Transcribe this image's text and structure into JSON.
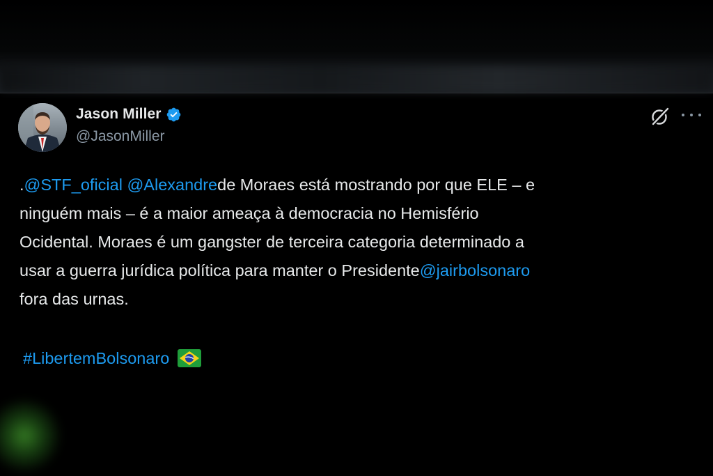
{
  "author": {
    "display_name": "Jason Miller",
    "handle": "@JasonMiller",
    "verified": true,
    "avatar_icon": "profile-photo"
  },
  "actions": {
    "grok_icon": "grok-icon",
    "more_icon": "more-options-icon"
  },
  "tweet": {
    "line1": {
      "prefix": ".",
      "mention1": "@STF_oficial",
      "space": " ",
      "mention2": "@Alexandre",
      "rest": "de Moraes está mostrando por que ELE – e"
    },
    "line2": "ninguém mais – é a maior ameaça à democracia no Hemisfério",
    "line3": "Ocidental. Moraes é um gangster de terceira categoria determinado a",
    "line4": {
      "text": "usar a guerra jurídica política para manter o Presidente",
      "mention": "@jairbolsonaro"
    },
    "line5": "fora das urnas.",
    "hashtag": "#LibertemBolsonaro",
    "emoji": "brazil-flag"
  },
  "colors": {
    "background": "#000000",
    "text": "#e7e9ea",
    "secondary_text": "#8b98a5",
    "link": "#1d9bf0",
    "verified_badge": "#1d9bf0"
  }
}
